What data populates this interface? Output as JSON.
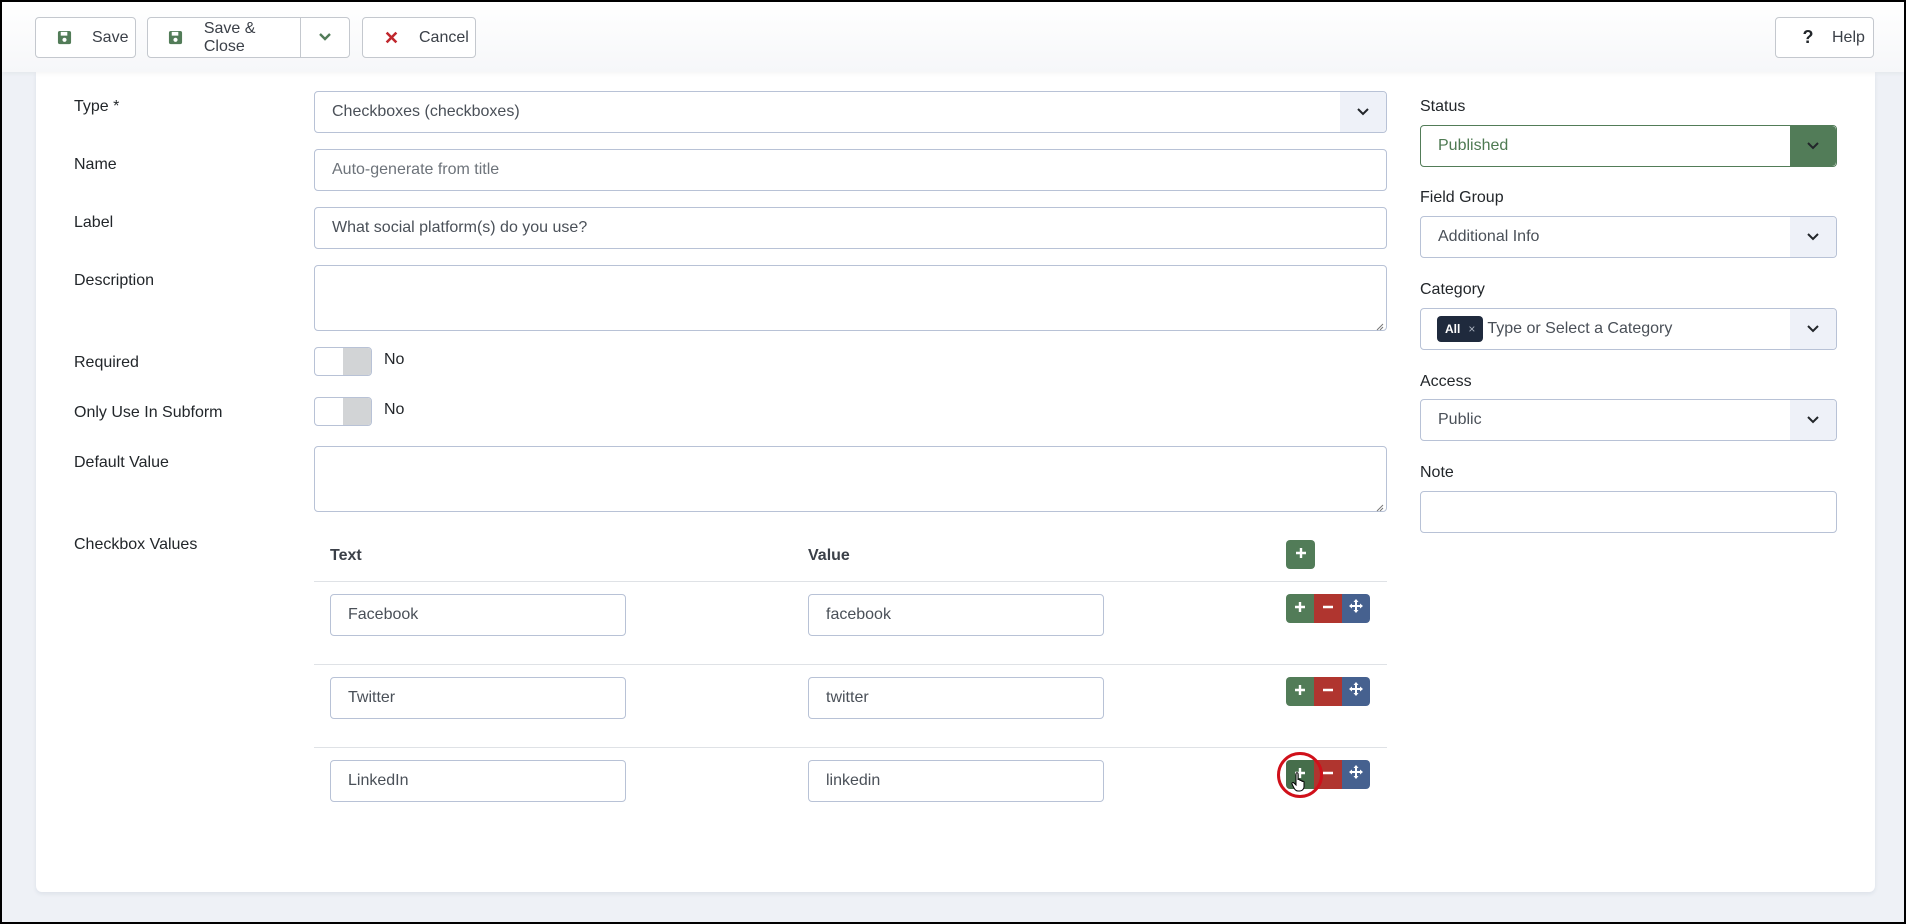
{
  "toolbar": {
    "save_label": "Save",
    "save_close_label": "Save & Close",
    "cancel_label": "Cancel",
    "help_label": "Help",
    "icons": {
      "save": "floppy-disk-icon",
      "save_close": "floppy-disk-icon",
      "dropdown": "chevron-down-icon",
      "cancel": "x-icon",
      "help": "question-icon"
    }
  },
  "form": {
    "type": {
      "label": "Type *",
      "value": "Checkboxes (checkboxes)"
    },
    "name": {
      "label": "Name",
      "placeholder": "Auto-generate from title",
      "value": ""
    },
    "label": {
      "label": "Label",
      "value": "What social platform(s) do you use?"
    },
    "description": {
      "label": "Description",
      "value": ""
    },
    "required": {
      "label": "Required",
      "value": "No"
    },
    "only_subform": {
      "label": "Only Use In Subform",
      "value": "No"
    },
    "default_value": {
      "label": "Default Value",
      "value": ""
    },
    "checkbox_values": {
      "label": "Checkbox Values",
      "columns": {
        "text": "Text",
        "value": "Value"
      },
      "rows": [
        {
          "text": "Facebook",
          "value": "facebook"
        },
        {
          "text": "Twitter",
          "value": "twitter"
        },
        {
          "text": "LinkedIn",
          "value": "linkedin"
        }
      ]
    }
  },
  "sidebar": {
    "status": {
      "label": "Status",
      "value": "Published"
    },
    "field_group": {
      "label": "Field Group",
      "value": "Additional Info"
    },
    "category": {
      "label": "Category",
      "chip": "All",
      "chip_remove": "×",
      "placeholder": "Type or Select a Category"
    },
    "access": {
      "label": "Access",
      "value": "Public"
    },
    "note": {
      "label": "Note",
      "value": ""
    }
  },
  "colors": {
    "success": "#527c58",
    "danger": "#b0352f",
    "primary": "#46618f",
    "chip": "#1f2a3d"
  }
}
